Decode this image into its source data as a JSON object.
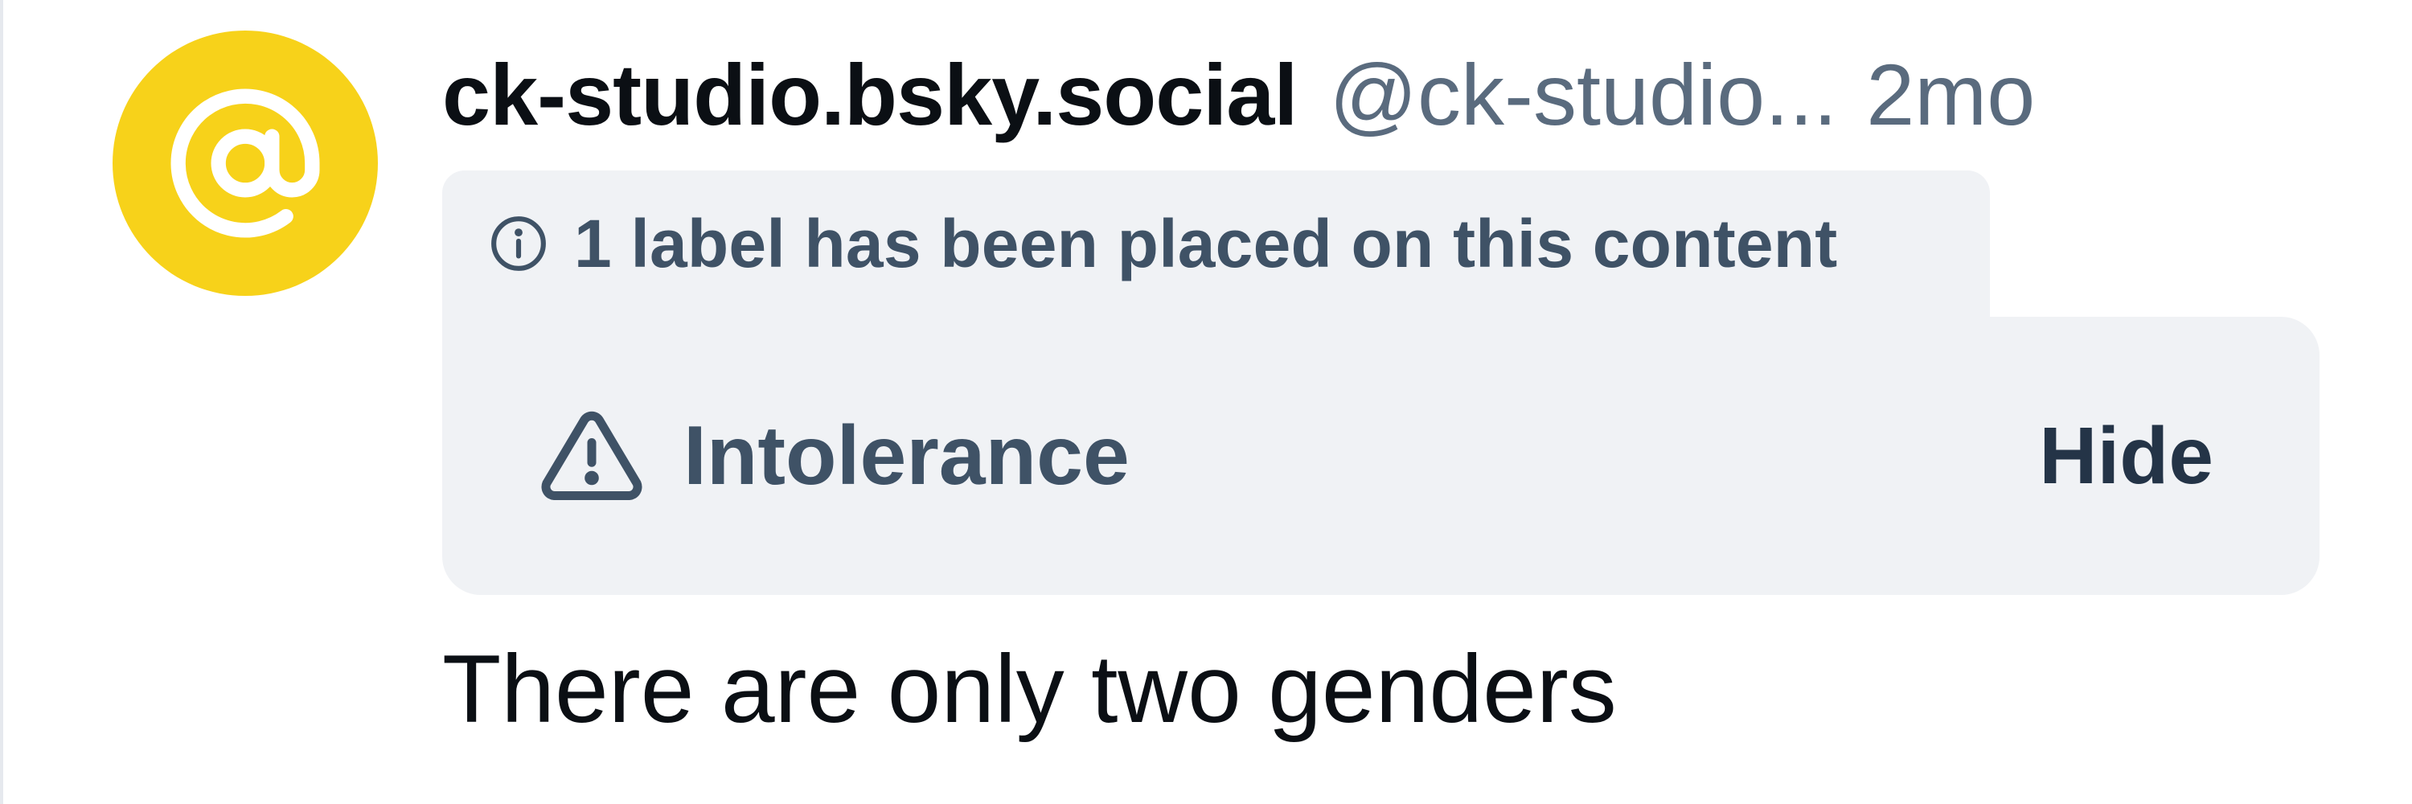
{
  "post": {
    "display_name": "ck-studio.bsky.social",
    "handle": "@ck-studio...",
    "time": "2mo",
    "avatar_icon": "at-sign-icon",
    "avatar_color": "#f7d21a",
    "text": "There are only two genders"
  },
  "moderation": {
    "info_icon": "info-icon",
    "label_notice": "1 label has been placed on this content",
    "warning_icon": "warning-triangle-icon",
    "warning_label": "Intolerance",
    "hide_label": "Hide"
  },
  "colors": {
    "muted_text": "#5a6b7e",
    "card_background": "#f0f2f5",
    "label_text": "#3f5266"
  }
}
